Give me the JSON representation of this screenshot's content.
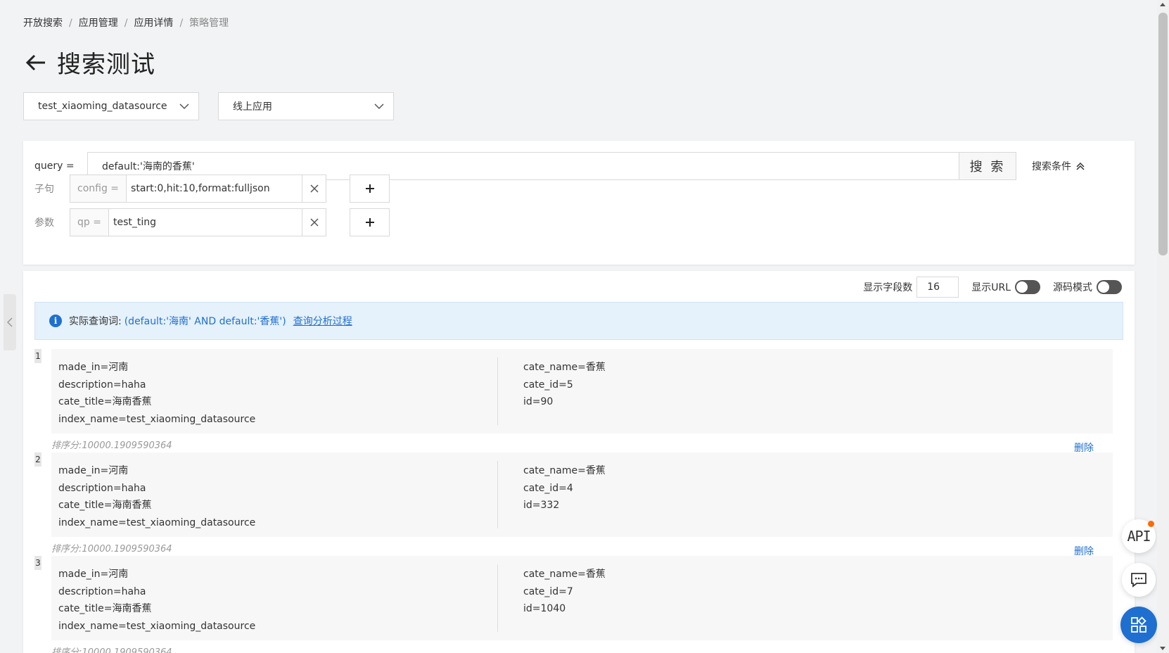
{
  "breadcrumb": [
    "开放搜索",
    "应用管理",
    "应用详情",
    "策略管理"
  ],
  "page_title": "搜索测试",
  "selects": {
    "datasource": "test_xiaoming_datasource",
    "environment": "线上应用"
  },
  "query": {
    "label": "query =",
    "value": "default:'海南的香蕉'",
    "search_button": "搜 索",
    "conditions_toggle": "搜索条件"
  },
  "clause": {
    "label": "子句",
    "key": "config =",
    "value": "start:0,hit:10,format:fulljson"
  },
  "params": {
    "label": "参数",
    "key": "qp =",
    "value": "test_ting"
  },
  "toolbar": {
    "field_count_label": "显示字段数",
    "field_count": "16",
    "show_url_label": "显示URL",
    "source_mode_label": "源码模式"
  },
  "info": {
    "label": "实际查询词:",
    "query": "(default:'海南' AND default:'香蕉')",
    "link": "查询分析过程"
  },
  "results": [
    {
      "index": "1",
      "left": [
        "made_in=河南",
        "description=haha",
        "cate_title=海南香蕉",
        "index_name=test_xiaoming_datasource"
      ],
      "right": [
        "cate_name=香蕉",
        "cate_id=5",
        "id=90"
      ],
      "score": "排序分:10000.1909590364",
      "delete": "删除"
    },
    {
      "index": "2",
      "left": [
        "made_in=河南",
        "description=haha",
        "cate_title=海南香蕉",
        "index_name=test_xiaoming_datasource"
      ],
      "right": [
        "cate_name=香蕉",
        "cate_id=4",
        "id=332"
      ],
      "score": "排序分:10000.1909590364",
      "delete": "删除"
    },
    {
      "index": "3",
      "left": [
        "made_in=河南",
        "description=haha",
        "cate_title=海南香蕉",
        "index_name=test_xiaoming_datasource"
      ],
      "right": [
        "cate_name=香蕉",
        "cate_id=7",
        "id=1040"
      ],
      "score": "排序分:10000.1909590364",
      "delete": "删除"
    }
  ],
  "floating": {
    "api_label": "API"
  },
  "icons": {
    "back": "arrow-left-icon",
    "select": "chevron-down-icon",
    "conditions": "chevron-up-icon",
    "clear": "close-icon",
    "add": "plus-icon",
    "info": "info-icon",
    "chat": "chat-icon",
    "apps": "apps-icon"
  },
  "colors": {
    "accent": "#1f6fd1",
    "info_bg": "#e5f1fb",
    "notify_dot": "#ff6a00"
  }
}
